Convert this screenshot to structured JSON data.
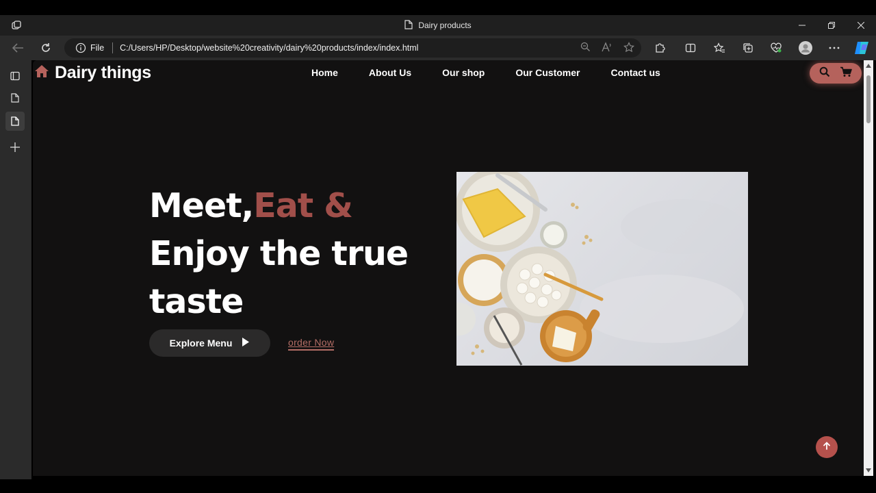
{
  "browser": {
    "tab_title": "Dairy products",
    "address_prefix": "File",
    "url": "C:/Users/HP/Desktop/website%20creativity/dairy%20products/index/index.html"
  },
  "site": {
    "logo_text": "Dairy things",
    "nav": [
      "Home",
      "About Us",
      "Our shop",
      "Our Customer",
      "Contact us"
    ]
  },
  "hero": {
    "line1_main": "Meet,",
    "line1_accent": "Eat &",
    "line2": "Enjoy the true",
    "line3": "taste",
    "explore_label": "Explore Menu",
    "order_label": "order Now"
  },
  "colors": {
    "page_bg": "#121111",
    "accent": "#a14f4a",
    "pill": "#b5625c",
    "up_button": "#b5514c"
  },
  "icons": [
    "home-icon",
    "search-icon",
    "cart-icon",
    "play-icon",
    "arrow-up-icon"
  ]
}
